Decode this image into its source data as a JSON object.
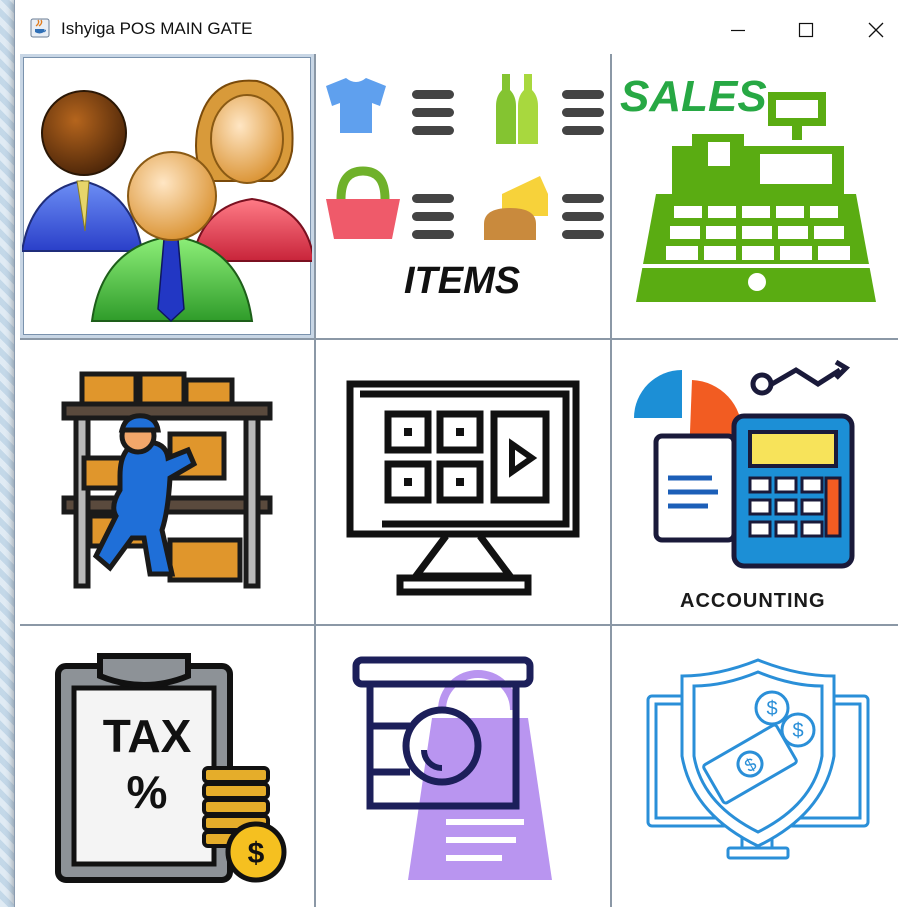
{
  "window": {
    "title": "Ishyiga POS MAIN GATE",
    "controls": {
      "minimize": "minimize-icon",
      "maximize": "maximize-icon",
      "close": "close-icon"
    }
  },
  "tiles": [
    {
      "name": "users",
      "icon": "users-group-icon",
      "label": ""
    },
    {
      "name": "items",
      "icon": "items-icon",
      "label": "ITEMS"
    },
    {
      "name": "sales",
      "icon": "cash-register-icon",
      "label": "SALES"
    },
    {
      "name": "stock",
      "icon": "warehouse-worker-icon",
      "label": ""
    },
    {
      "name": "display",
      "icon": "media-monitor-icon",
      "label": ""
    },
    {
      "name": "accounting",
      "icon": "calculator-chart-icon",
      "label": "ACCOUNTING"
    },
    {
      "name": "tax",
      "icon": "tax-clipboard-icon",
      "label": "TAX %"
    },
    {
      "name": "shop",
      "icon": "shop-bag-icon",
      "label": ""
    },
    {
      "name": "payment",
      "icon": "secure-payment-icon",
      "label": ""
    }
  ],
  "colors": {
    "sales_green": "#27a844",
    "register_green": "#5aac12",
    "accounting_blue": "#1c8fd6",
    "shop_purple": "#b995f0",
    "payment_blue": "#2a8fd8"
  }
}
